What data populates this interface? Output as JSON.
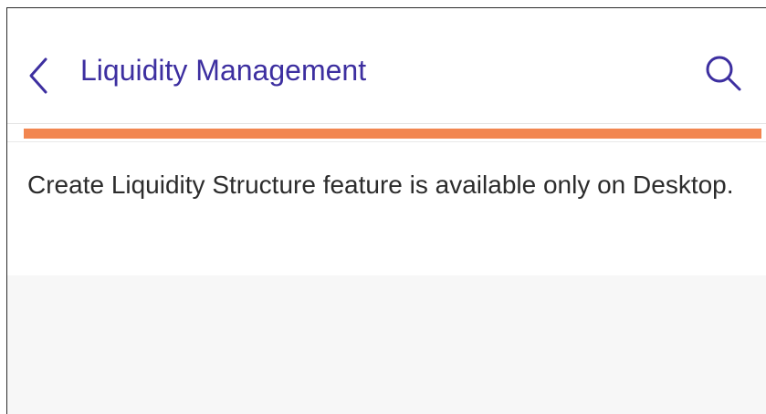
{
  "header": {
    "title": "Liquidity Management",
    "back_icon": "chevron-left-icon",
    "search_icon": "search-icon"
  },
  "message": {
    "text": "Create Liquidity Structure feature is available only on Desktop."
  },
  "colors": {
    "title": "#3d2fa0",
    "accent_bar": "#f28650",
    "message_text": "#2c2c2c",
    "empty_background": "#f7f7f7"
  }
}
